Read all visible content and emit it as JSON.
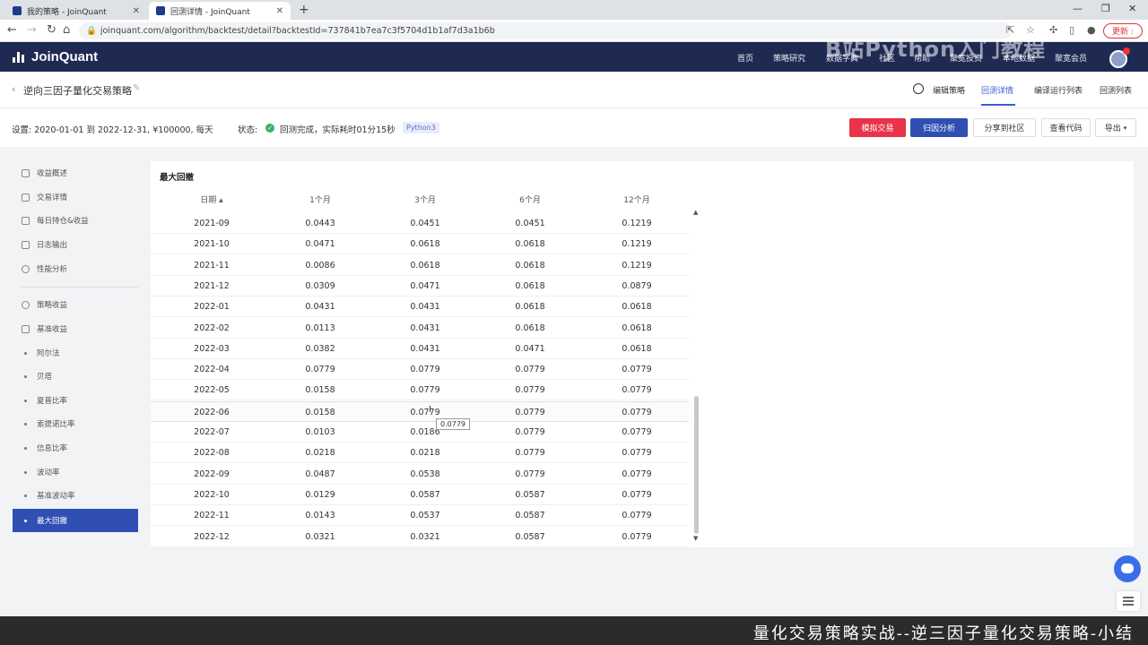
{
  "browser": {
    "tabs": [
      {
        "title": "我的策略 - JoinQuant"
      },
      {
        "title": "回测详情 - JoinQuant"
      }
    ],
    "url": "joinquant.com/algorithm/backtest/detail?backtestId=737841b7ea7c3f5704d1b1af7d3a1b6b",
    "update_label": "更新 :"
  },
  "header": {
    "logo": "JoinQuant",
    "nav": [
      "首页",
      "策略研究",
      "数据字典",
      "社区",
      "帮助",
      "聚宽投资",
      "本地数据",
      "聚宽会员"
    ],
    "watermark": "B站Python入门教程"
  },
  "titlebar": {
    "strategy_name": "逆向三因子量化交易策略",
    "tabs": [
      "编辑策略",
      "回测详情",
      "编译运行列表",
      "回测列表"
    ],
    "active_tab": "回测详情"
  },
  "settings": {
    "text": "设置:  2020-01-01 到 2022-12-31,  ¥100000,  每天",
    "status_label": "状态:",
    "status_text": "回测完成，实际耗时01分15秒",
    "python_badge": "Python3",
    "buttons": [
      "模拟交易",
      "归因分析",
      "分享到社区",
      "查看代码",
      "导出"
    ]
  },
  "sidebar": {
    "items": [
      {
        "label": "收益概述",
        "type": "icon"
      },
      {
        "label": "交易详情",
        "type": "icon"
      },
      {
        "label": "每日持仓&收益",
        "type": "icon"
      },
      {
        "label": "日志输出",
        "type": "icon"
      },
      {
        "label": "性能分析",
        "type": "icon"
      },
      {
        "label": "策略收益",
        "type": "icon"
      },
      {
        "label": "基准收益",
        "type": "icon"
      },
      {
        "label": "阿尔法",
        "type": "dot"
      },
      {
        "label": "贝塔",
        "type": "dot"
      },
      {
        "label": "夏普比率",
        "type": "dot"
      },
      {
        "label": "索提诺比率",
        "type": "dot"
      },
      {
        "label": "信息比率",
        "type": "dot"
      },
      {
        "label": "波动率",
        "type": "dot"
      },
      {
        "label": "基准波动率",
        "type": "dot"
      },
      {
        "label": "最大回撤",
        "type": "dot",
        "active": true
      }
    ]
  },
  "table": {
    "title": "最大回撤",
    "columns": [
      "日期 ▴",
      "1个月",
      "3个月",
      "6个月",
      "12个月"
    ],
    "rows": [
      [
        "2021-09",
        "0.0443",
        "0.0451",
        "0.0451",
        "0.1219"
      ],
      [
        "2021-10",
        "0.0471",
        "0.0618",
        "0.0618",
        "0.1219"
      ],
      [
        "2021-11",
        "0.0086",
        "0.0618",
        "0.0618",
        "0.1219"
      ],
      [
        "2021-12",
        "0.0309",
        "0.0471",
        "0.0618",
        "0.0879"
      ],
      [
        "2022-01",
        "0.0431",
        "0.0431",
        "0.0618",
        "0.0618"
      ],
      [
        "2022-02",
        "0.0113",
        "0.0431",
        "0.0618",
        "0.0618"
      ],
      [
        "2022-03",
        "0.0382",
        "0.0431",
        "0.0471",
        "0.0618"
      ],
      [
        "2022-04",
        "0.0779",
        "0.0779",
        "0.0779",
        "0.0779"
      ],
      [
        "2022-05",
        "0.0158",
        "0.0779",
        "0.0779",
        "0.0779"
      ],
      [
        "2022-06",
        "0.0158",
        "0.0779",
        "0.0779",
        "0.0779"
      ],
      [
        "2022-07",
        "0.0103",
        "0.0186",
        "0.0779",
        "0.0779"
      ],
      [
        "2022-08",
        "0.0218",
        "0.0218",
        "0.0779",
        "0.0779"
      ],
      [
        "2022-09",
        "0.0487",
        "0.0538",
        "0.0779",
        "0.0779"
      ],
      [
        "2022-10",
        "0.0129",
        "0.0587",
        "0.0587",
        "0.0779"
      ],
      [
        "2022-11",
        "0.0143",
        "0.0537",
        "0.0587",
        "0.0779"
      ],
      [
        "2022-12",
        "0.0321",
        "0.0321",
        "0.0587",
        "0.0779"
      ]
    ],
    "hover_row": 9,
    "tooltip": "0.0779"
  },
  "subtitle": "量化交易策略实战--逆三因子量化交易策略-小结",
  "colors": {
    "header_bg": "#1e2a52",
    "accent": "#2f4fb3",
    "danger": "#e8334a",
    "success": "#3bb16a"
  }
}
